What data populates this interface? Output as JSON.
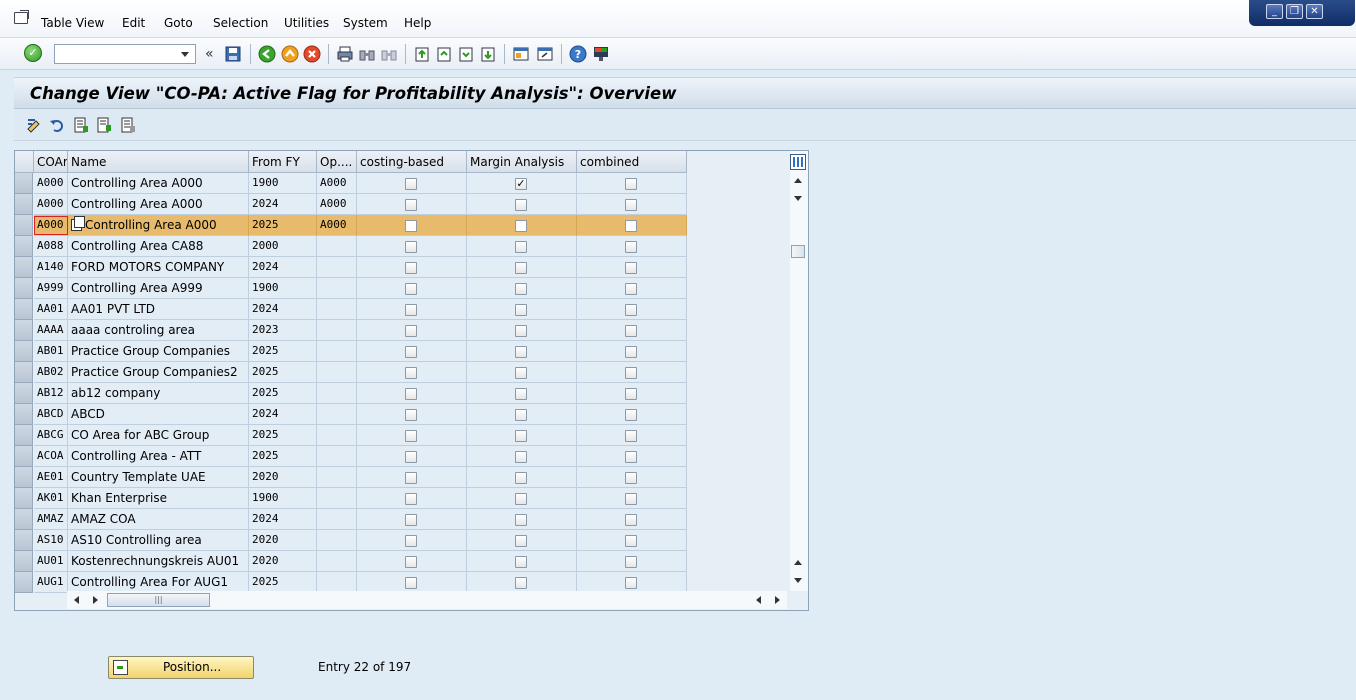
{
  "menu": [
    "Table View",
    "Edit",
    "Goto",
    "Selection",
    "Utilities",
    "System",
    "Help"
  ],
  "title": "Change View \"CO-PA: Active Flag for Profitability Analysis\": Overview",
  "columns": [
    "COAr",
    "Name",
    "From FY",
    "Op....",
    "costing-based",
    "Margin Analysis",
    "combined"
  ],
  "rows": [
    {
      "coar": "A000",
      "name": "Controlling Area A000",
      "fy": "1900",
      "op": "A000",
      "costing": false,
      "margin": true,
      "combined": false
    },
    {
      "coar": "A000",
      "name": "Controlling Area A000",
      "fy": "2024",
      "op": "A000",
      "costing": false,
      "margin": false,
      "combined": false
    },
    {
      "coar": "A000",
      "name": "Controlling Area A000",
      "fy": "2025",
      "op": "A000",
      "costing": false,
      "margin": false,
      "combined": false,
      "selected": true
    },
    {
      "coar": "A088",
      "name": "Controlling Area CA88",
      "fy": "2000",
      "op": "",
      "costing": false,
      "margin": false,
      "combined": false
    },
    {
      "coar": "A140",
      "name": "FORD MOTORS COMPANY",
      "fy": "2024",
      "op": "",
      "costing": false,
      "margin": false,
      "combined": false
    },
    {
      "coar": "A999",
      "name": "Controlling Area A999",
      "fy": "1900",
      "op": "",
      "costing": false,
      "margin": false,
      "combined": false
    },
    {
      "coar": "AA01",
      "name": "AA01 PVT LTD",
      "fy": "2024",
      "op": "",
      "costing": false,
      "margin": false,
      "combined": false
    },
    {
      "coar": "AAAA",
      "name": "aaaa controling area",
      "fy": "2023",
      "op": "",
      "costing": false,
      "margin": false,
      "combined": false
    },
    {
      "coar": "AB01",
      "name": "Practice Group Companies",
      "fy": "2025",
      "op": "",
      "costing": false,
      "margin": false,
      "combined": false
    },
    {
      "coar": "AB02",
      "name": "Practice Group Companies2",
      "fy": "2025",
      "op": "",
      "costing": false,
      "margin": false,
      "combined": false
    },
    {
      "coar": "AB12",
      "name": "ab12 company",
      "fy": "2025",
      "op": "",
      "costing": false,
      "margin": false,
      "combined": false
    },
    {
      "coar": "ABCD",
      "name": "ABCD",
      "fy": "2024",
      "op": "",
      "costing": false,
      "margin": false,
      "combined": false
    },
    {
      "coar": "ABCG",
      "name": "CO Area for ABC Group",
      "fy": "2025",
      "op": "",
      "costing": false,
      "margin": false,
      "combined": false
    },
    {
      "coar": "ACOA",
      "name": "Controlling Area - ATT",
      "fy": "2025",
      "op": "",
      "costing": false,
      "margin": false,
      "combined": false
    },
    {
      "coar": "AE01",
      "name": "Country Template UAE",
      "fy": "2020",
      "op": "",
      "costing": false,
      "margin": false,
      "combined": false
    },
    {
      "coar": "AK01",
      "name": "Khan Enterprise",
      "fy": "1900",
      "op": "",
      "costing": false,
      "margin": false,
      "combined": false
    },
    {
      "coar": "AMAZ",
      "name": "AMAZ COA",
      "fy": "2024",
      "op": "",
      "costing": false,
      "margin": false,
      "combined": false
    },
    {
      "coar": "AS10",
      "name": "AS10 Controlling area",
      "fy": "2020",
      "op": "",
      "costing": false,
      "margin": false,
      "combined": false
    },
    {
      "coar": "AU01",
      "name": "Kostenrechnungskreis AU01",
      "fy": "2020",
      "op": "",
      "costing": false,
      "margin": false,
      "combined": false
    },
    {
      "coar": "AUG1",
      "name": "Controlling Area For AUG1",
      "fy": "2025",
      "op": "",
      "costing": false,
      "margin": false,
      "combined": false
    }
  ],
  "position_button": "Position...",
  "entry_text": "Entry 22 of 197",
  "colors": {
    "selected_row": "#e8ba6c",
    "cell_bg": "#e3edf6",
    "title_bg": "#cfdde9"
  }
}
